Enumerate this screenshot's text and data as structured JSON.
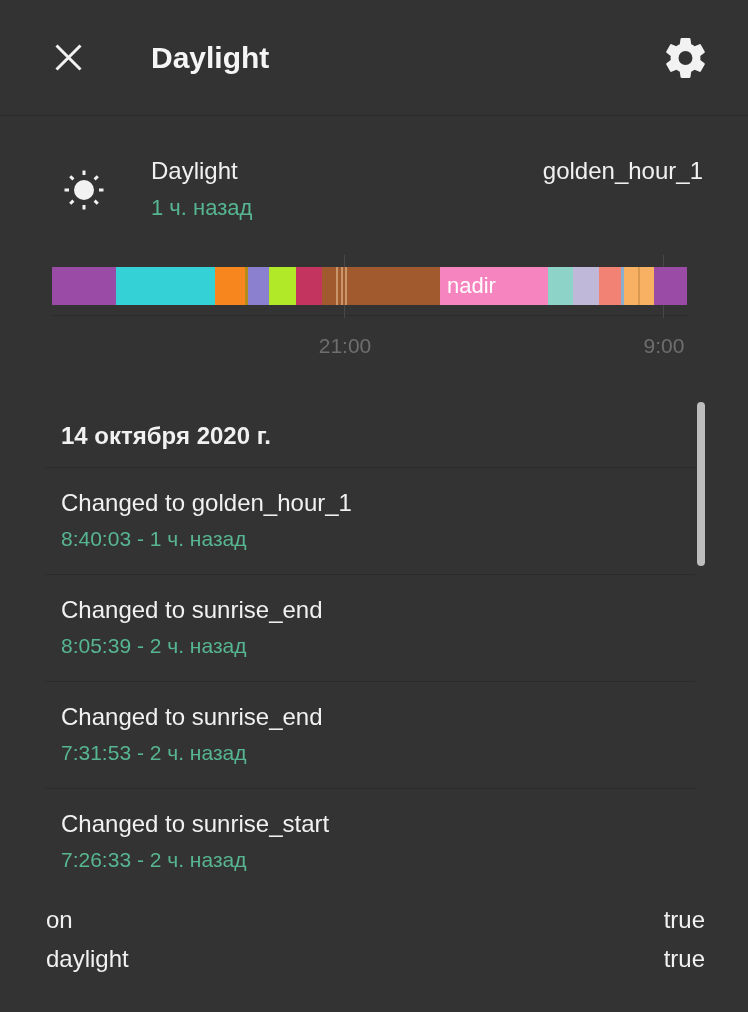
{
  "dialog": {
    "title": "Daylight"
  },
  "entity": {
    "name": "Daylight",
    "last_changed": "1 ч. назад",
    "state": "golden_hour_1"
  },
  "timeline": {
    "segments": [
      {
        "color": "#9a4ba5"
      },
      {
        "color": "#34d2d6"
      },
      {
        "color": "#f8861e"
      },
      {
        "color": "#b38c1a"
      },
      {
        "color": "#8a80cf"
      },
      {
        "color": "#b1e827"
      },
      {
        "color": "#c3345f"
      },
      {
        "color": "#a15a2d"
      },
      {
        "color": "#c8966a"
      },
      {
        "color": "#a15a2d"
      },
      {
        "color": "#c8966a"
      },
      {
        "color": "#a15a2d"
      },
      {
        "color": "#c8966a"
      },
      {
        "color": "#a15a2d"
      },
      {
        "color": "#f684be",
        "label": "nadir"
      },
      {
        "color": "#8ed3c7"
      },
      {
        "color": "#bfb8d9"
      },
      {
        "color": "#f28274"
      },
      {
        "color": "#8aaed0"
      },
      {
        "color": "#f8b062"
      },
      {
        "color": "#d99a50"
      },
      {
        "color": "#f8b062"
      },
      {
        "color": "#9a4ba5"
      }
    ],
    "ticks": [
      "21:00",
      "9:00"
    ]
  },
  "logbook": {
    "date": "14 октября 2020 г.",
    "entries": [
      {
        "message": "Changed to golden_hour_1",
        "time": "8:40:03 - 1 ч. назад"
      },
      {
        "message": "Changed to sunrise_end",
        "time": "8:05:39 - 2 ч. назад"
      },
      {
        "message": "Changed to sunrise_end",
        "time": "7:31:53 - 2 ч. назад"
      },
      {
        "message": "Changed to sunrise_start",
        "time": "7:26:33 - 2 ч. назад"
      }
    ]
  },
  "attributes": [
    {
      "name": "on",
      "value": "true"
    },
    {
      "name": "daylight",
      "value": "true"
    }
  ]
}
